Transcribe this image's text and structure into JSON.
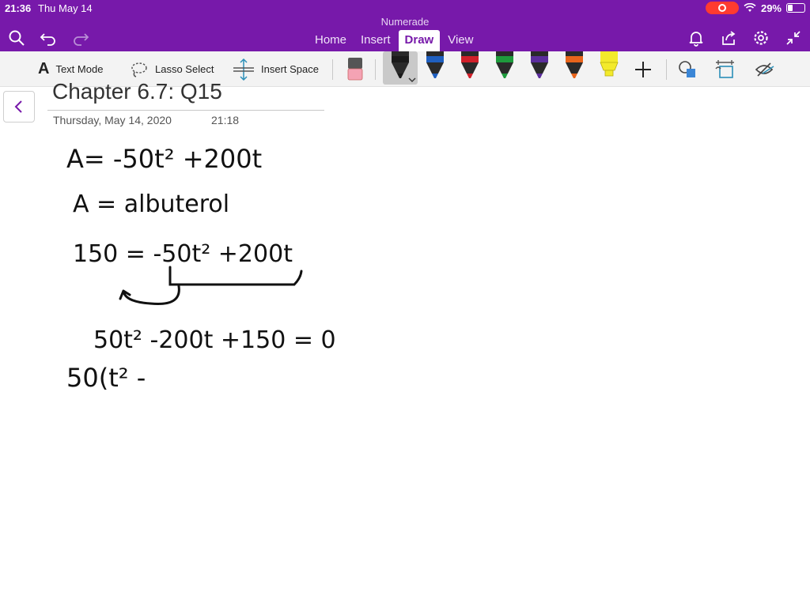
{
  "status_bar": {
    "time": "21:36",
    "date": "Thu May 14",
    "battery": "29%",
    "battery_level": 0.29
  },
  "app": {
    "title": "Numerade"
  },
  "tabs": [
    {
      "label": "Home"
    },
    {
      "label": "Insert"
    },
    {
      "label": "Draw",
      "active": true
    },
    {
      "label": "View"
    }
  ],
  "ribbon": {
    "text_mode": "Text Mode",
    "lasso_select": "Lasso Select",
    "insert_space": "Insert Space",
    "pens": [
      {
        "name": "black",
        "color": "#1a1a1a",
        "selected": true
      },
      {
        "name": "blue",
        "color": "#1f5fbf"
      },
      {
        "name": "red",
        "color": "#d0202a"
      },
      {
        "name": "green",
        "color": "#1e9a3c"
      },
      {
        "name": "purple",
        "color": "#5b2d9c"
      },
      {
        "name": "orange",
        "color": "#e8641b"
      },
      {
        "name": "yellow-highlighter",
        "color": "#f3ea2b"
      }
    ]
  },
  "page": {
    "title": "Chapter 6.7: Q15",
    "date": "Thursday, May 14, 2020",
    "time": "21:18"
  },
  "handwriting": {
    "line1": "A= -50t² +200t",
    "line2": "A = albuterol",
    "line3": "150 = -50t² +200t",
    "line4": "50t² -200t +150 = 0",
    "line5": "50(t² -"
  },
  "colors": {
    "accent": "#7719aa",
    "ribbon_bg": "#f3f3f3"
  }
}
